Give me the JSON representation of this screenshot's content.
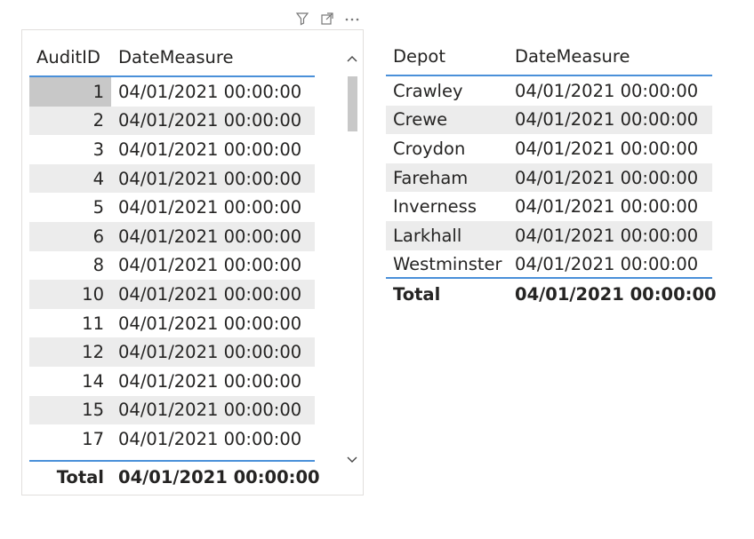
{
  "header_icons": {
    "filter": "filter-icon",
    "focus": "focus-mode-icon",
    "more": "more-options-icon"
  },
  "left_table": {
    "columns": [
      "AuditID",
      "DateMeasure"
    ],
    "rows": [
      {
        "id": "1",
        "date": "04/01/2021 00:00:00"
      },
      {
        "id": "2",
        "date": "04/01/2021 00:00:00"
      },
      {
        "id": "3",
        "date": "04/01/2021 00:00:00"
      },
      {
        "id": "4",
        "date": "04/01/2021 00:00:00"
      },
      {
        "id": "5",
        "date": "04/01/2021 00:00:00"
      },
      {
        "id": "6",
        "date": "04/01/2021 00:00:00"
      },
      {
        "id": "8",
        "date": "04/01/2021 00:00:00"
      },
      {
        "id": "10",
        "date": "04/01/2021 00:00:00"
      },
      {
        "id": "11",
        "date": "04/01/2021 00:00:00"
      },
      {
        "id": "12",
        "date": "04/01/2021 00:00:00"
      },
      {
        "id": "14",
        "date": "04/01/2021 00:00:00"
      },
      {
        "id": "15",
        "date": "04/01/2021 00:00:00"
      },
      {
        "id": "17",
        "date": "04/01/2021 00:00:00"
      }
    ],
    "total": {
      "label": "Total",
      "date": "04/01/2021 00:00:00"
    }
  },
  "right_table": {
    "columns": [
      "Depot",
      "DateMeasure"
    ],
    "rows": [
      {
        "depot": "Crawley",
        "date": "04/01/2021 00:00:00"
      },
      {
        "depot": "Crewe",
        "date": "04/01/2021 00:00:00"
      },
      {
        "depot": "Croydon",
        "date": "04/01/2021 00:00:00"
      },
      {
        "depot": "Fareham",
        "date": "04/01/2021 00:00:00"
      },
      {
        "depot": "Inverness",
        "date": "04/01/2021 00:00:00"
      },
      {
        "depot": "Larkhall",
        "date": "04/01/2021 00:00:00"
      },
      {
        "depot": "Westminster",
        "date": "04/01/2021 00:00:00"
      }
    ],
    "total": {
      "label": "Total",
      "date": "04/01/2021 00:00:00"
    }
  },
  "colors": {
    "accent": "#4a90d9",
    "alt_row": "#ececec",
    "selected_cell": "#c8c8c8",
    "border": "#e1dfdd"
  }
}
